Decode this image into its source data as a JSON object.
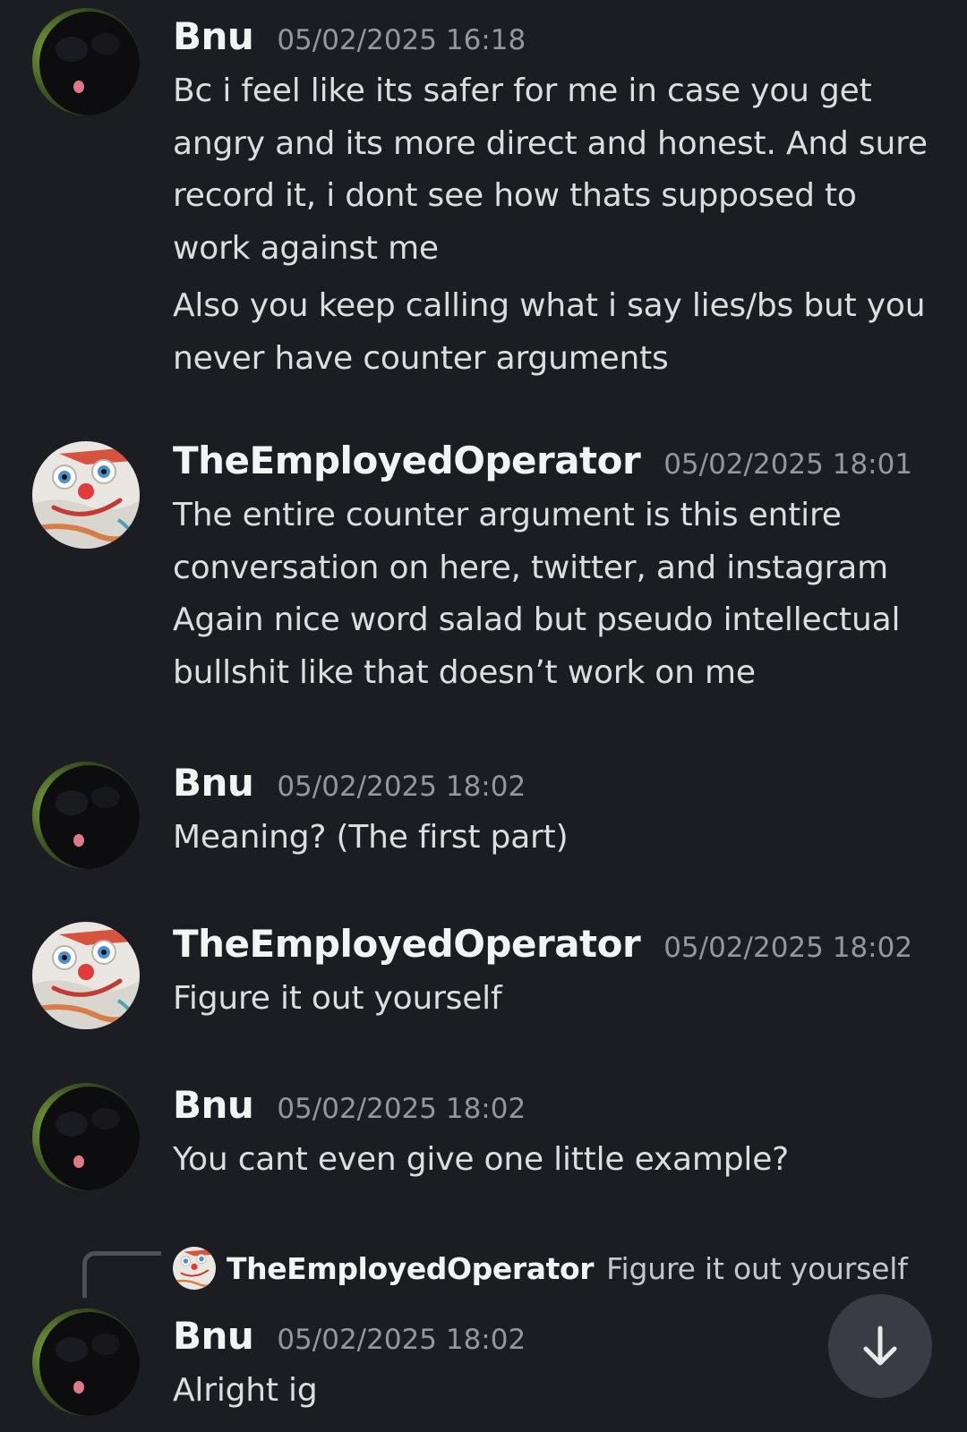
{
  "messages": [
    {
      "author": "Bnu",
      "timestamp": "05/02/2025 16:18",
      "avatar": "black-bunny-avatar",
      "paragraphs": [
        [
          "Bc i feel like its safer for me in case you get",
          "angry and its more direct and honest. And sure",
          "record it, i dont see how thats supposed to",
          "work against me"
        ],
        [
          "Also you keep calling what i say lies/bs but you",
          "never have counter arguments"
        ]
      ]
    },
    {
      "author": "TheEmployedOperator",
      "timestamp": "05/02/2025 18:01",
      "avatar": "cartoon-face-avatar",
      "paragraphs": [
        [
          "The entire counter argument is this entire",
          "conversation on here, twitter, and instagram"
        ],
        [
          "Again nice word salad but pseudo intellectual",
          "bullshit like that doesn’t work on me"
        ]
      ]
    },
    {
      "author": "Bnu",
      "timestamp": "05/02/2025 18:02",
      "avatar": "black-bunny-avatar",
      "paragraphs": [
        [
          "Meaning? (The first part)"
        ]
      ]
    },
    {
      "author": "TheEmployedOperator",
      "timestamp": "05/02/2025 18:02",
      "avatar": "cartoon-face-avatar",
      "paragraphs": [
        [
          "Figure it out yourself"
        ]
      ]
    },
    {
      "author": "Bnu",
      "timestamp": "05/02/2025 18:02",
      "avatar": "black-bunny-avatar",
      "paragraphs": [
        [
          "You cant even give one little example?"
        ]
      ]
    },
    {
      "author": "Bnu",
      "timestamp": "05/02/2025 18:02",
      "avatar": "black-bunny-avatar",
      "reply_to": {
        "author": "TheEmployedOperator",
        "text": "Figure it out yourself",
        "avatar": "cartoon-face-avatar"
      },
      "paragraphs": [
        [
          "Alright ig"
        ]
      ]
    }
  ],
  "jump_button": {
    "icon": "arrow-down-icon"
  },
  "colors": {
    "background": "#1c1d22",
    "author": "#f2f3f5",
    "timestamp": "#94979e",
    "text": "#dbdee1",
    "jump_button": "#3a3c43"
  }
}
